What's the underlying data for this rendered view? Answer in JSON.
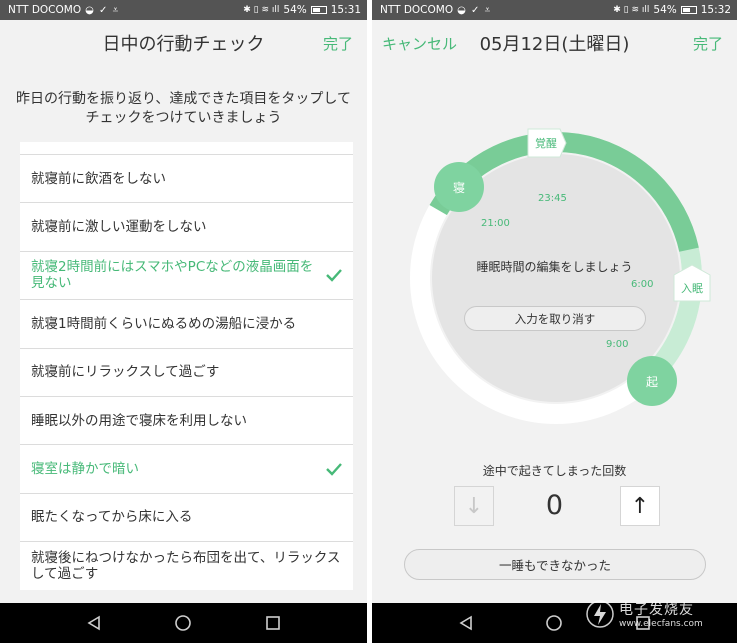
{
  "colors": {
    "accent": "#47b978",
    "ring_light": "#d7f0e0",
    "ring_dark": "#7fd3a0",
    "statusbar": "#545454"
  },
  "left": {
    "status": {
      "carrier": "NTT DOCOMO",
      "battery": "54%",
      "time": "15:31"
    },
    "header": {
      "title": "日中の行動チェック",
      "done": "完了"
    },
    "instruction": "昨日の行動を振り返り、達成できた項目をタップしてチェックをつけていきましょう",
    "items": [
      {
        "label": "就寝前に飲酒をしない",
        "checked": false
      },
      {
        "label": "就寝前に激しい運動をしない",
        "checked": false
      },
      {
        "label": "就寝2時間前にはスマホやPCなどの液晶画面を見ない",
        "checked": true
      },
      {
        "label": "就寝1時間前くらいにぬるめの湯船に浸かる",
        "checked": false
      },
      {
        "label": "就寝前にリラックスして過ごす",
        "checked": false
      },
      {
        "label": "睡眠以外の用途で寝床を利用しない",
        "checked": false
      },
      {
        "label": "寝室は静かで暗い",
        "checked": true
      },
      {
        "label": "眠たくなってから床に入る",
        "checked": false
      },
      {
        "label": "就寝後にねつけなかったら布団を出て、リラックスして過ごす",
        "checked": false
      }
    ]
  },
  "right": {
    "status": {
      "carrier": "NTT DOCOMO",
      "battery": "54%",
      "time": "15:32"
    },
    "header": {
      "cancel": "キャンセル",
      "date": "05月12日(土曜日)",
      "done": "完了"
    },
    "clock": {
      "wake_tag": "覚醒",
      "sleep_tag": "入眠",
      "bed_bubble": "寝",
      "rise_bubble": "起",
      "times": [
        "23:45",
        "21:00",
        "6:00",
        "9:00"
      ],
      "prompt": "睡眠時間の編集をしましょう",
      "undo": "入力を取り消す"
    },
    "wakeups": {
      "label": "途中で起きてしまった回数",
      "count": "0",
      "down": "↓",
      "up": "↑"
    },
    "no_sleep": "一睡もできなかった"
  },
  "watermark": {
    "name": "电子发烧友",
    "url": "www.elecfans.com"
  }
}
